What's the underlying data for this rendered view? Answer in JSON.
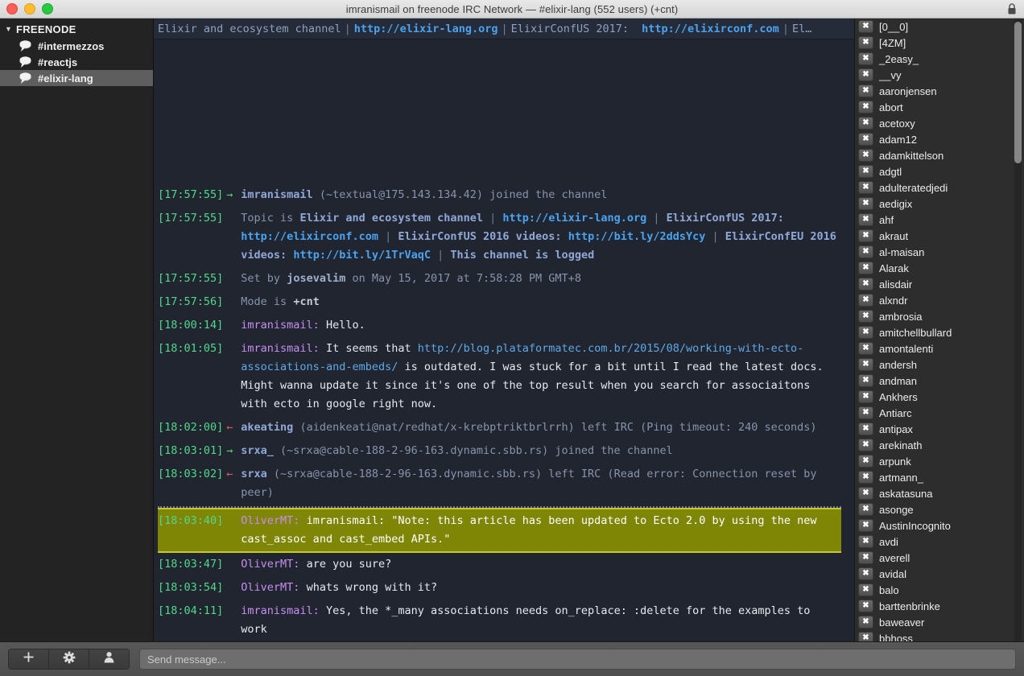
{
  "window": {
    "title": "imranismail on freenode IRC Network — #elixir-lang (552 users) (+cnt)",
    "lock_icon": "lock-icon"
  },
  "sidebar": {
    "server": {
      "label": "FREENODE",
      "disclosure": "▼"
    },
    "channels": [
      {
        "label": "#intermezzos",
        "selected": false
      },
      {
        "label": "#reactjs",
        "selected": false
      },
      {
        "label": "#elixir-lang",
        "selected": true
      }
    ]
  },
  "topic": {
    "p1": "Elixir and ecosystem channel",
    "s1": "|",
    "l1": "http://elixir-lang.org",
    "s2": "|",
    "p2": "ElixirConfUS 2017:",
    "l2": "http://elixirconf.com",
    "s3": "|",
    "p3": "El…"
  },
  "messages": [
    {
      "id": "join-imranismail",
      "ts": "[17:57:55]",
      "kind": "join",
      "arrow": "→",
      "parts": [
        {
          "t": "nick-b",
          "v": "imranismail"
        },
        {
          "t": "dim",
          "v": " (~textual@175.143.134.42) joined the channel"
        }
      ]
    },
    {
      "id": "topic-line",
      "ts": "[17:57:55]",
      "kind": "event",
      "arrow": "",
      "parts": [
        {
          "t": "dim",
          "v": "Topic is "
        },
        {
          "t": "topic-b",
          "v": "Elixir and ecosystem channel"
        },
        {
          "t": "sep",
          "v": " | "
        },
        {
          "t": "link",
          "v": "http://elixir-lang.org"
        },
        {
          "t": "sep",
          "v": " | "
        },
        {
          "t": "topic-b",
          "v": "ElixirConfUS 2017: "
        },
        {
          "t": "link",
          "v": "http://elixirconf.com"
        },
        {
          "t": "sep",
          "v": " | "
        },
        {
          "t": "topic-b",
          "v": "ElixirConfUS 2016 videos: "
        },
        {
          "t": "link",
          "v": "http://bit.ly/2ddsYcy"
        },
        {
          "t": "sep",
          "v": " | "
        },
        {
          "t": "topic-b",
          "v": "ElixirConfEU 2016 videos: "
        },
        {
          "t": "link",
          "v": "http://bit.ly/1TrVaqC"
        },
        {
          "t": "sep",
          "v": " | "
        },
        {
          "t": "topic-b",
          "v": "This channel is logged"
        }
      ]
    },
    {
      "id": "set-by",
      "ts": "[17:57:55]",
      "kind": "event",
      "arrow": "",
      "parts": [
        {
          "t": "dim",
          "v": "Set by "
        },
        {
          "t": "dim-b",
          "v": "josevalim"
        },
        {
          "t": "dim",
          "v": " on May 15, 2017 at 7:58:28 PM GMT+8"
        }
      ]
    },
    {
      "id": "mode-line",
      "ts": "[17:57:56]",
      "kind": "event",
      "arrow": "",
      "parts": [
        {
          "t": "dim",
          "v": "Mode is "
        },
        {
          "t": "mode",
          "v": "+cnt"
        }
      ]
    },
    {
      "id": "msg-hello",
      "ts": "[18:00:14]",
      "kind": "privmsg",
      "arrow": "",
      "parts": [
        {
          "t": "nick-self",
          "v": "imranismail: "
        },
        {
          "t": "body",
          "v": "Hello."
        }
      ]
    },
    {
      "id": "msg-outdated",
      "ts": "[18:01:05]",
      "kind": "privmsg",
      "arrow": "",
      "parts": [
        {
          "t": "nick-self",
          "v": "imranismail: "
        },
        {
          "t": "body",
          "v": "It seems that "
        },
        {
          "t": "link-plain",
          "v": "http://blog.plataformatec.com.br/2015/08/working-with-ecto-associations-and-embeds/"
        },
        {
          "t": "body",
          "v": " is outdated. I was stuck for a bit until I read the latest docs. Might wanna update it since it's one of the top result when you search for associaitons with ecto in google right now."
        }
      ]
    },
    {
      "id": "part-akeating",
      "ts": "[18:02:00]",
      "kind": "part",
      "arrow": "←",
      "parts": [
        {
          "t": "nick-b",
          "v": "akeating"
        },
        {
          "t": "dim",
          "v": " (aidenkeati@nat/redhat/x-krebptriktbrlrrh) left IRC (Ping timeout: 240 seconds)"
        }
      ]
    },
    {
      "id": "join-srxa",
      "ts": "[18:03:01]",
      "kind": "join",
      "arrow": "→",
      "parts": [
        {
          "t": "nick-b",
          "v": "srxa_"
        },
        {
          "t": "dim",
          "v": " (~srxa@cable-188-2-96-163.dynamic.sbb.rs) joined the channel"
        }
      ]
    },
    {
      "id": "part-srxa",
      "ts": "[18:03:02]",
      "kind": "part",
      "arrow": "←",
      "parts": [
        {
          "t": "nick-b",
          "v": "srxa"
        },
        {
          "t": "dim",
          "v": " (~srxa@cable-188-2-96-163.dynamic.sbb.rs) left IRC (Read error: Connection reset by peer)"
        }
      ]
    },
    {
      "id": "msg-highlight-note",
      "ts": "[18:03:40]",
      "kind": "privmsg",
      "highlight": true,
      "unread_marker_above": true,
      "arrow": "",
      "parts": [
        {
          "t": "nick-other",
          "v": "OliverMT: "
        },
        {
          "t": "body",
          "v": "imranismail: \"Note: this article has been updated to Ecto 2.0 by using the new cast_assoc and cast_embed APIs.\""
        }
      ]
    },
    {
      "id": "msg-are-you-sure",
      "ts": "[18:03:47]",
      "kind": "privmsg",
      "arrow": "",
      "parts": [
        {
          "t": "nick-other",
          "v": "OliverMT: "
        },
        {
          "t": "body",
          "v": "are you sure?"
        }
      ]
    },
    {
      "id": "msg-whats-wrong",
      "ts": "[18:03:54]",
      "kind": "privmsg",
      "arrow": "",
      "parts": [
        {
          "t": "nick-other",
          "v": "OliverMT: "
        },
        {
          "t": "body",
          "v": "whats wrong with it?"
        }
      ]
    },
    {
      "id": "msg-yes-many",
      "ts": "[18:04:11]",
      "kind": "privmsg",
      "arrow": "",
      "parts": [
        {
          "t": "nick-self",
          "v": "imranismail: "
        },
        {
          "t": "body",
          "v": "Yes, the *_many associations needs on_replace: :delete for the examples to work"
        }
      ]
    }
  ],
  "userlist": {
    "badge_glyph": "✖",
    "users": [
      "[0__0]",
      "[4ZM]",
      "_2easy_",
      "__vy",
      "aaronjensen",
      "abort",
      "acetoxy",
      "adam12",
      "adamkittelson",
      "adgtl",
      "adulteratedjedi",
      "aedigix",
      "ahf",
      "akraut",
      "al-maisan",
      "Alarak",
      "alisdair",
      "alxndr",
      "ambrosia",
      "amitchellbullard",
      "amontalenti",
      "andersh",
      "andman",
      "Ankhers",
      "Antiarc",
      "antipax",
      "arekinath",
      "arpunk",
      "artmann_",
      "askatasuna",
      "asonge",
      "AustinIncognito",
      "avdi",
      "averell",
      "avidal",
      "balo",
      "barttenbrinke",
      "baweaver",
      "bbhoss"
    ]
  },
  "bottombar": {
    "buttons": [
      {
        "name": "add-button",
        "glyph": "+"
      },
      {
        "name": "settings-button",
        "glyph": "gear-icon"
      },
      {
        "name": "user-button",
        "glyph": "person-icon"
      }
    ],
    "input_placeholder": "Send message..."
  }
}
